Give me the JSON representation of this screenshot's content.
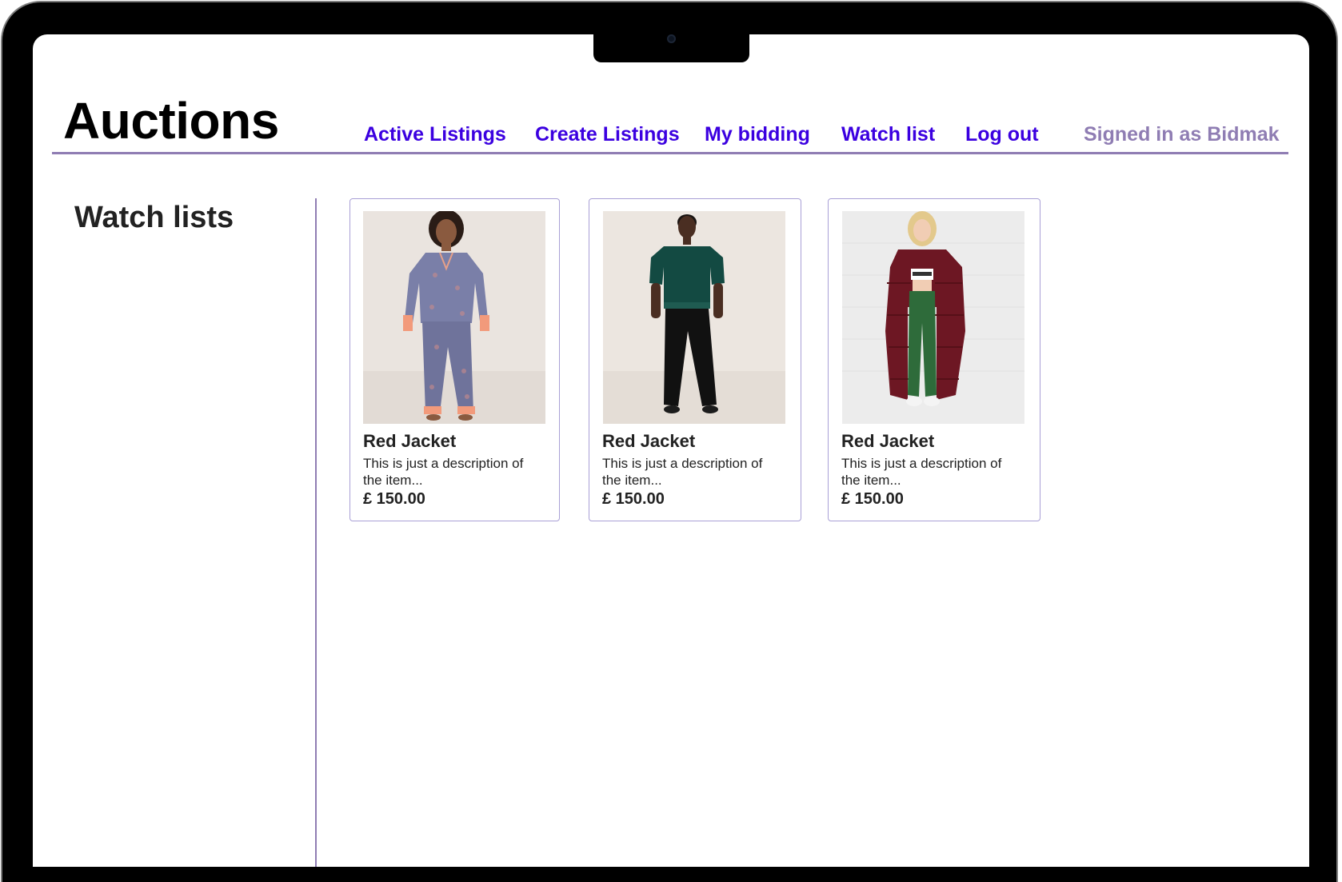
{
  "header": {
    "logo": "Auctions",
    "nav": [
      {
        "label": "Active Listings"
      },
      {
        "label": "Create Listings"
      },
      {
        "label": "My bidding"
      },
      {
        "label": "Watch list"
      },
      {
        "label": "Log out"
      }
    ],
    "signed_in": "Signed in as Bidmak"
  },
  "sidebar": {
    "title": "Watch lists"
  },
  "cards": [
    {
      "title": "Red Jacket",
      "description": "This is just a description of the item...",
      "price": "£ 150.00"
    },
    {
      "title": "Red Jacket",
      "description": "This is just a description of the item...",
      "price": "£ 150.00"
    },
    {
      "title": "Red Jacket",
      "description": "This is just a description of the item...",
      "price": "£ 150.00"
    }
  ],
  "colors": {
    "accent": "#3b00e0",
    "muted": "#8f7db3",
    "card_border": "#a9a0d6"
  }
}
